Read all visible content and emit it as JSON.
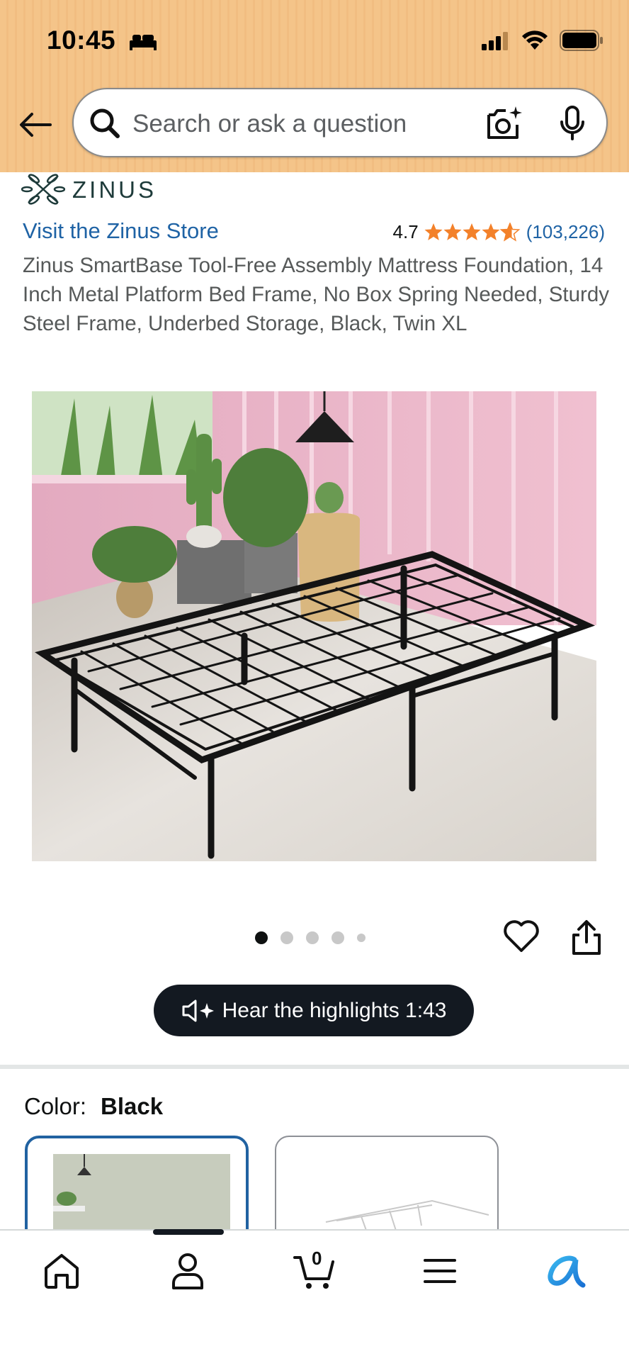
{
  "status_bar": {
    "time": "10:45"
  },
  "search": {
    "placeholder": "Search or ask a question"
  },
  "brand": {
    "name": "ZINUS",
    "store_link": "Visit the Zinus Store"
  },
  "rating": {
    "value": "4.7",
    "stars": 4.7,
    "count": "(103,226)"
  },
  "product": {
    "title": "Zinus SmartBase Tool-Free Assembly Mattress Foundation, 14 Inch Metal Platform Bed Frame, No Box Spring Needed, Sturdy Steel Frame, Underbed Storage, Black, Twin XL"
  },
  "carousel": {
    "dot_count": 5,
    "active_index": 0
  },
  "audio": {
    "label": "Hear the highlights 1:43"
  },
  "color": {
    "label": "Color:",
    "value": "Black"
  },
  "colors": {
    "header_bg": "#f4c489",
    "link": "#1f63a5",
    "star": "#f3812a",
    "selected_border": "#2162a1"
  },
  "nav": {
    "cart_count": "0"
  }
}
